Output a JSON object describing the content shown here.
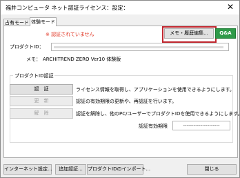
{
  "window": {
    "title": "福井コンピュータ ネット認証ライセンス：設定：",
    "close_glyph": "✕"
  },
  "tabs": [
    {
      "label": "占有モード",
      "active": false
    },
    {
      "label": "体験モード",
      "active": true
    }
  ],
  "status": {
    "warning": "※ 認証されていません",
    "warning_color": "#e0301e"
  },
  "toolbar": {
    "memo_history_button": "メモ・履歴編集...",
    "qa_button": "Q&A"
  },
  "product": {
    "product_id_label": "プロダクトID：",
    "product_id_value": "",
    "memo_label": "メモ：",
    "memo_value": "ARCHITREND ZERO Ver10 体験版"
  },
  "auth_group": {
    "title": "プロダクトID認証",
    "actions": [
      {
        "button": "認　証",
        "description": "ライセンス情報を取得し、アプリケーションを使用できるようにします。",
        "enabled": true
      },
      {
        "button": "更　新",
        "description": "認証の有効期限の更新や、再認証を行います。",
        "enabled": false
      },
      {
        "button": "解　除",
        "description": "認証を解除し、他のPC/ユーザーでプロダクトIDを使用できるようにします。",
        "enabled": false
      }
    ],
    "expiry_label": "認証有効期限",
    "expiry_value": "---------------------"
  },
  "footer": {
    "internet_settings": "インターネット設定...",
    "add_auth": "追加認証...",
    "import_pid": "プロダクトIDのインポート...",
    "close": "閉じる"
  },
  "colors": {
    "highlight_border": "#c0262e",
    "qa_green": "#2e9a48"
  }
}
